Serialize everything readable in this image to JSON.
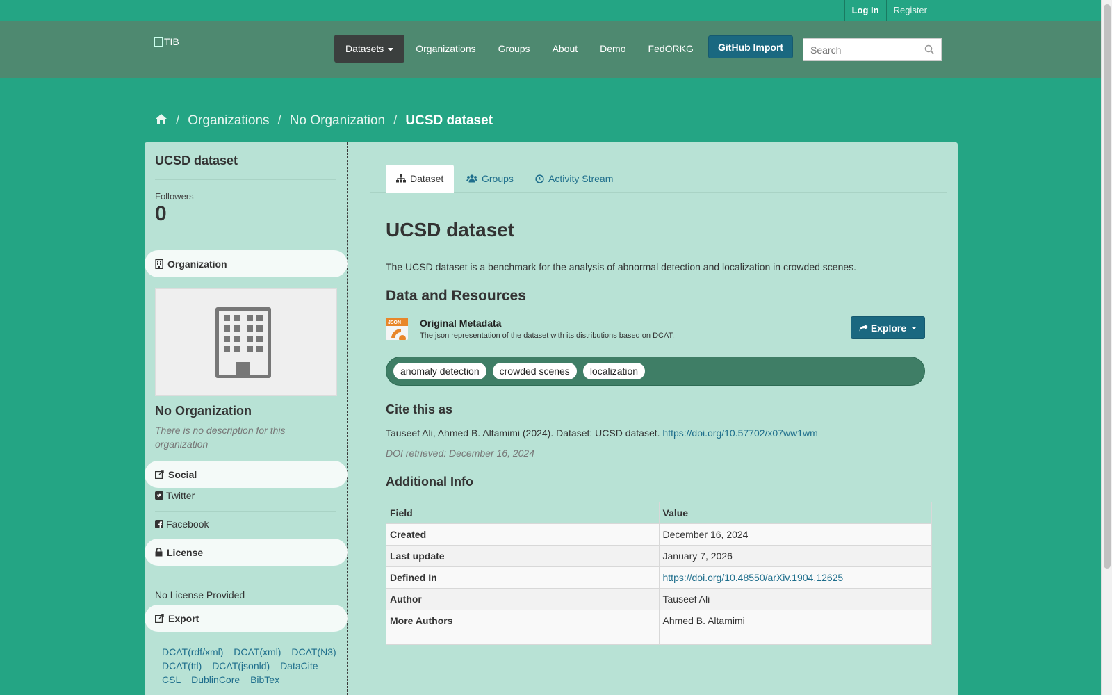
{
  "account": {
    "login": "Log In",
    "register": "Register"
  },
  "header": {
    "logo_alt": "TIB",
    "nav": [
      "Datasets",
      "Organizations",
      "Groups",
      "About",
      "Demo",
      "FedORKG"
    ],
    "github_import": "GitHub Import",
    "search_placeholder": "Search"
  },
  "breadcrumb": [
    "Organizations",
    "No Organization",
    "UCSD dataset"
  ],
  "sidebar": {
    "title": "UCSD dataset",
    "followers_label": "Followers",
    "followers_count": "0",
    "organization_heading": "Organization",
    "org_name": "No Organization",
    "org_description": "There is no description for this organization",
    "social_heading": "Social",
    "social_links": [
      "Twitter",
      "Facebook"
    ],
    "license_heading": "License",
    "license_text": "No License Provided",
    "export_heading": "Export",
    "export_links": [
      "DCAT(rdf/xml)",
      "DCAT(xml)",
      "DCAT(N3)",
      "DCAT(ttl)",
      "DCAT(jsonld)",
      "DataCite",
      "CSL",
      "DublinCore",
      "BibTex"
    ]
  },
  "tabs": [
    "Dataset",
    "Groups",
    "Activity Stream"
  ],
  "dataset": {
    "title": "UCSD dataset",
    "notes": "The UCSD dataset is a benchmark for the analysis of abnormal detection and localization in crowded scenes.",
    "resources_heading": "Data and Resources",
    "resource": {
      "icon_label": "JSON",
      "title": "Original Metadata",
      "description": "The json representation of the dataset with its distributions based on DCAT.",
      "explore": "Explore"
    },
    "tags": [
      "anomaly detection",
      "crowded scenes",
      "localization"
    ],
    "cite_heading": "Cite this as",
    "cite_text": "Tauseef Ali, Ahmed B. Altamimi (2024). Dataset: UCSD dataset.",
    "cite_doi": "https://doi.org/10.57702/x07ww1wm",
    "doi_retrieved": "DOI retrieved: December 16, 2024",
    "info_heading": "Additional Info",
    "info_columns": [
      "Field",
      "Value"
    ],
    "info_rows": [
      {
        "field": "Created",
        "value": "December 16, 2024"
      },
      {
        "field": "Last update",
        "value": "January 7, 2026"
      },
      {
        "field": "Defined In",
        "value": "https://doi.org/10.48550/arXiv.1904.12625"
      },
      {
        "field": "Author",
        "value": "Tauseef Ali"
      },
      {
        "field": "More Authors",
        "value": "Ahmed B. Altamimi"
      }
    ]
  },
  "colors": {
    "page_bg": "#24a584",
    "masthead": "#4e8970",
    "panel": "#b8e2d5",
    "button": "#1a6880",
    "link": "#1e6e8c",
    "tag_bar": "#3f7e66"
  }
}
